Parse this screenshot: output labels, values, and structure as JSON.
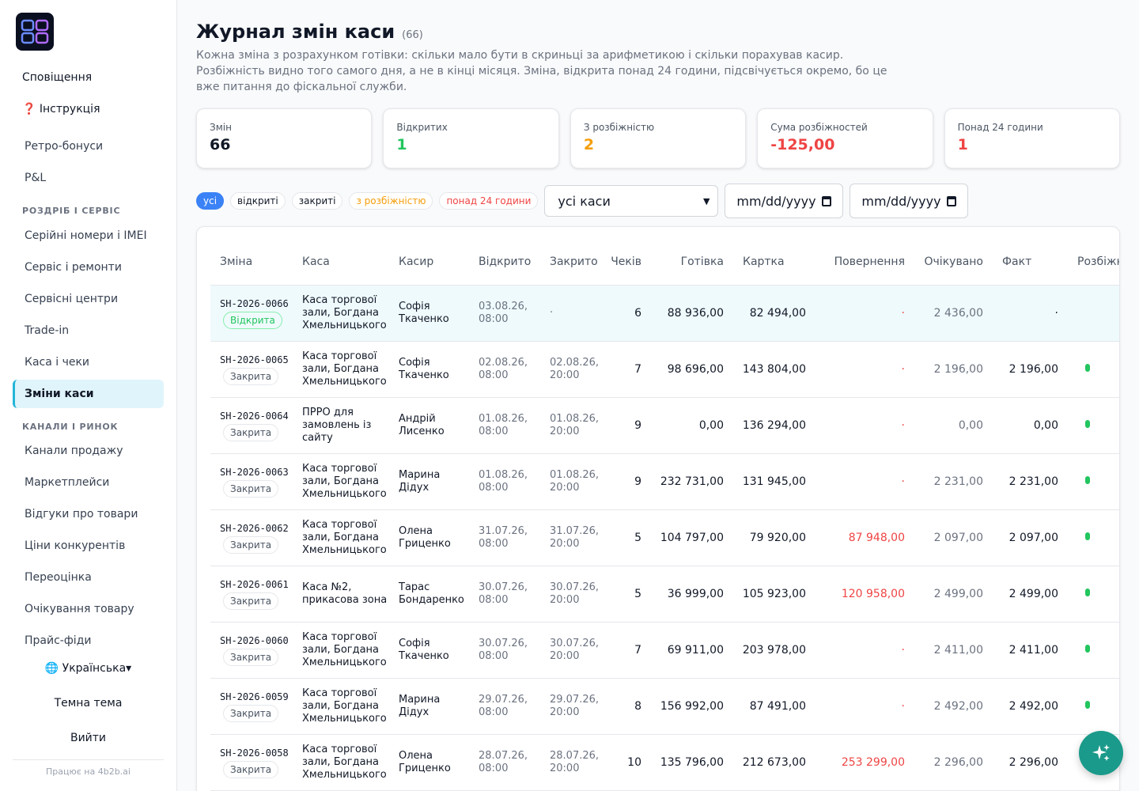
{
  "sidebar": {
    "top_items": [
      "Сповіщення",
      "❓ Інструкція"
    ],
    "items_a": [
      "Ретро-бонуси",
      "P&L"
    ],
    "section1": "РОЗДРІБ І СЕРВІС",
    "items_b": [
      "Серійні номери і IMEI",
      "Сервіс і ремонти",
      "Сервісні центри",
      "Trade-in",
      "Каса і чеки",
      "Зміни каси"
    ],
    "section2": "КАНАЛИ І РИНОК",
    "items_c": [
      "Канали продажу",
      "Маркетплейси",
      "Відгуки про товари",
      "Ціни конкурентів",
      "Переоцінка",
      "Очікування товару",
      "Прайс-фіди"
    ],
    "language": "🌐 Українська▾",
    "theme": "Темна тема",
    "logout": "Вийти",
    "footer": "Працює на 4b2b.ai"
  },
  "page": {
    "title": "Журнал змін каси",
    "count": "(66)",
    "description": "Кожна зміна з розрахунком готівки: скільки мало бути в скриньці за арифметикою і скільки порахував касир. Розбіжність видно того самого дня, а не в кінці місяця. Зміна, відкрита понад 24 години, підсвічується окремо, бо це вже питання до фіскальної служби."
  },
  "kpis": [
    {
      "label": "Змін",
      "value": "66",
      "color": "#111827"
    },
    {
      "label": "Відкритих",
      "value": "1",
      "color": "#22c55e"
    },
    {
      "label": "З розбіжністю",
      "value": "2",
      "color": "#f59e0b"
    },
    {
      "label": "Сума розбіжностей",
      "value": "-125,00",
      "color": "#ef4444"
    },
    {
      "label": "Понад 24 години",
      "value": "1",
      "color": "#ef4444"
    }
  ],
  "filters": {
    "chips": [
      "усі",
      "відкриті",
      "закриті",
      "з розбіжністю",
      "понад 24 години"
    ],
    "register_select": "усі каси",
    "date_from": "mm/dd/yyyy",
    "date_to": "mm/dd/yyyy"
  },
  "table": {
    "headers": [
      "Зміна",
      "Каса",
      "Касир",
      "Відкрито",
      "Закрито",
      "Чеків",
      "Готівка",
      "Картка",
      "Повернення",
      "Очікувано",
      "Факт",
      "Розбіжн"
    ],
    "rows": [
      {
        "code": "SH-2026-0066",
        "status": "Відкрита",
        "register": "Каса торгової зали, Богдана Хмельницького",
        "cashier": "Софія Ткаченко",
        "opened": "03.08.26, 08:00",
        "closed": "·",
        "checks": "6",
        "cash": "88 936,00",
        "card": "82 494,00",
        "refunds": "·",
        "expected": "2 436,00",
        "actual": "·"
      },
      {
        "code": "SH-2026-0065",
        "status": "Закрита",
        "register": "Каса торгової зали, Богдана Хмельницького",
        "cashier": "Софія Ткаченко",
        "opened": "02.08.26, 08:00",
        "closed": "02.08.26, 20:00",
        "checks": "7",
        "cash": "98 696,00",
        "card": "143 804,00",
        "refunds": "·",
        "expected": "2 196,00",
        "actual": "2 196,00"
      },
      {
        "code": "SH-2026-0064",
        "status": "Закрита",
        "register": "ПРРО для замовлень із сайту",
        "cashier": "Андрій Лисенко",
        "opened": "01.08.26, 08:00",
        "closed": "01.08.26, 20:00",
        "checks": "9",
        "cash": "0,00",
        "card": "136 294,00",
        "refunds": "·",
        "expected": "0,00",
        "actual": "0,00"
      },
      {
        "code": "SH-2026-0063",
        "status": "Закрита",
        "register": "Каса торгової зали, Богдана Хмельницького",
        "cashier": "Марина Дідух",
        "opened": "01.08.26, 08:00",
        "closed": "01.08.26, 20:00",
        "checks": "9",
        "cash": "232 731,00",
        "card": "131 945,00",
        "refunds": "·",
        "expected": "2 231,00",
        "actual": "2 231,00"
      },
      {
        "code": "SH-2026-0062",
        "status": "Закрита",
        "register": "Каса торгової зали, Богдана Хмельницького",
        "cashier": "Олена Гриценко",
        "opened": "31.07.26, 08:00",
        "closed": "31.07.26, 20:00",
        "checks": "5",
        "cash": "104 797,00",
        "card": "79 920,00",
        "refunds": "87 948,00",
        "expected": "2 097,00",
        "actual": "2 097,00"
      },
      {
        "code": "SH-2026-0061",
        "status": "Закрита",
        "register": "Каса №2, прикасова зона",
        "cashier": "Тарас Бондаренко",
        "opened": "30.07.26, 08:00",
        "closed": "30.07.26, 20:00",
        "checks": "5",
        "cash": "36 999,00",
        "card": "105 923,00",
        "refunds": "120 958,00",
        "expected": "2 499,00",
        "actual": "2 499,00"
      },
      {
        "code": "SH-2026-0060",
        "status": "Закрита",
        "register": "Каса торгової зали, Богдана Хмельницького",
        "cashier": "Софія Ткаченко",
        "opened": "30.07.26, 08:00",
        "closed": "30.07.26, 20:00",
        "checks": "7",
        "cash": "69 911,00",
        "card": "203 978,00",
        "refunds": "·",
        "expected": "2 411,00",
        "actual": "2 411,00"
      },
      {
        "code": "SH-2026-0059",
        "status": "Закрита",
        "register": "Каса торгової зали, Богдана Хмельницького",
        "cashier": "Марина Дідух",
        "opened": "29.07.26, 08:00",
        "closed": "29.07.26, 20:00",
        "checks": "8",
        "cash": "156 992,00",
        "card": "87 491,00",
        "refunds": "·",
        "expected": "2 492,00",
        "actual": "2 492,00"
      },
      {
        "code": "SH-2026-0058",
        "status": "Закрита",
        "register": "Каса торгової зали, Богдана Хмельницького",
        "cashier": "Олена Гриценко",
        "opened": "28.07.26, 08:00",
        "closed": "28.07.26, 20:00",
        "checks": "10",
        "cash": "135 796,00",
        "card": "212 673,00",
        "refunds": "253 299,00",
        "expected": "2 296,00",
        "actual": "2 296,00"
      }
    ]
  },
  "fab_icon": "sparkles-icon"
}
